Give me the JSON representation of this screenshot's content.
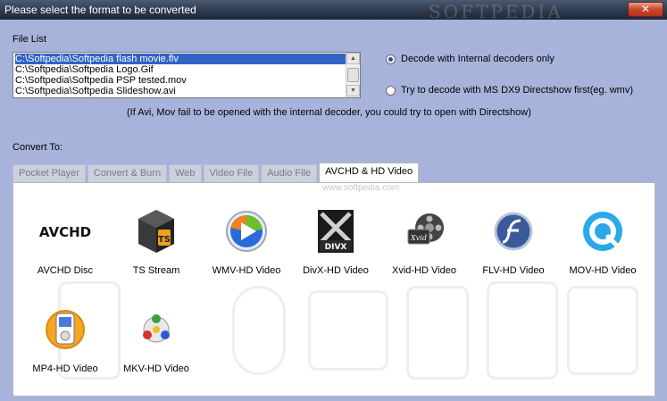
{
  "window": {
    "title": "Please select the format to be converted",
    "watermark": "SOFTPEDIA",
    "close_label": "✕"
  },
  "file_list": {
    "label": "File List",
    "items": [
      "C:\\Softpedia\\Softpedia flash movie.flv",
      "C:\\Softpedia\\Softpedia Logo.Gif",
      "C:\\Softpedia\\Softpedia PSP tested.mov",
      "C:\\Softpedia\\Softpedia Slideshow.avi"
    ]
  },
  "decode_options": {
    "internal": "Decode with Internal decoders only",
    "directshow": "Try to decode with MS DX9 Directshow first(eg. wmv)",
    "selected": "internal"
  },
  "note": "(If Avi, Mov fail to be opened with the internal decoder, you could try to open with Directshow)",
  "convert_to": {
    "label": "Convert To:",
    "tabs": [
      "Pocket  Player",
      "Convert & Burn",
      "Web",
      "Video  File",
      "Audio  File",
      "AVCHD & HD Video"
    ],
    "active_tab": "AVCHD & HD Video",
    "panel_watermark": "www.softpedia.com",
    "formats": [
      {
        "label": "AVCHD Disc",
        "icon": "avchd-icon"
      },
      {
        "label": "TS Stream",
        "icon": "ts-stream-icon"
      },
      {
        "label": "WMV-HD Video",
        "icon": "wmv-icon"
      },
      {
        "label": "DivX-HD Video",
        "icon": "divx-icon"
      },
      {
        "label": "Xvid-HD Video",
        "icon": "xvid-icon"
      },
      {
        "label": "FLV-HD Video",
        "icon": "flv-icon"
      },
      {
        "label": "MOV-HD Video",
        "icon": "mov-icon"
      },
      {
        "label": "MP4-HD Video",
        "icon": "mp4-icon"
      },
      {
        "label": "MKV-HD Video",
        "icon": "mkv-icon"
      }
    ],
    "icon_text": {
      "avchd": "AVCHD",
      "ts": "TS",
      "divx": "DIVX",
      "xvid": "Xvid"
    }
  }
}
